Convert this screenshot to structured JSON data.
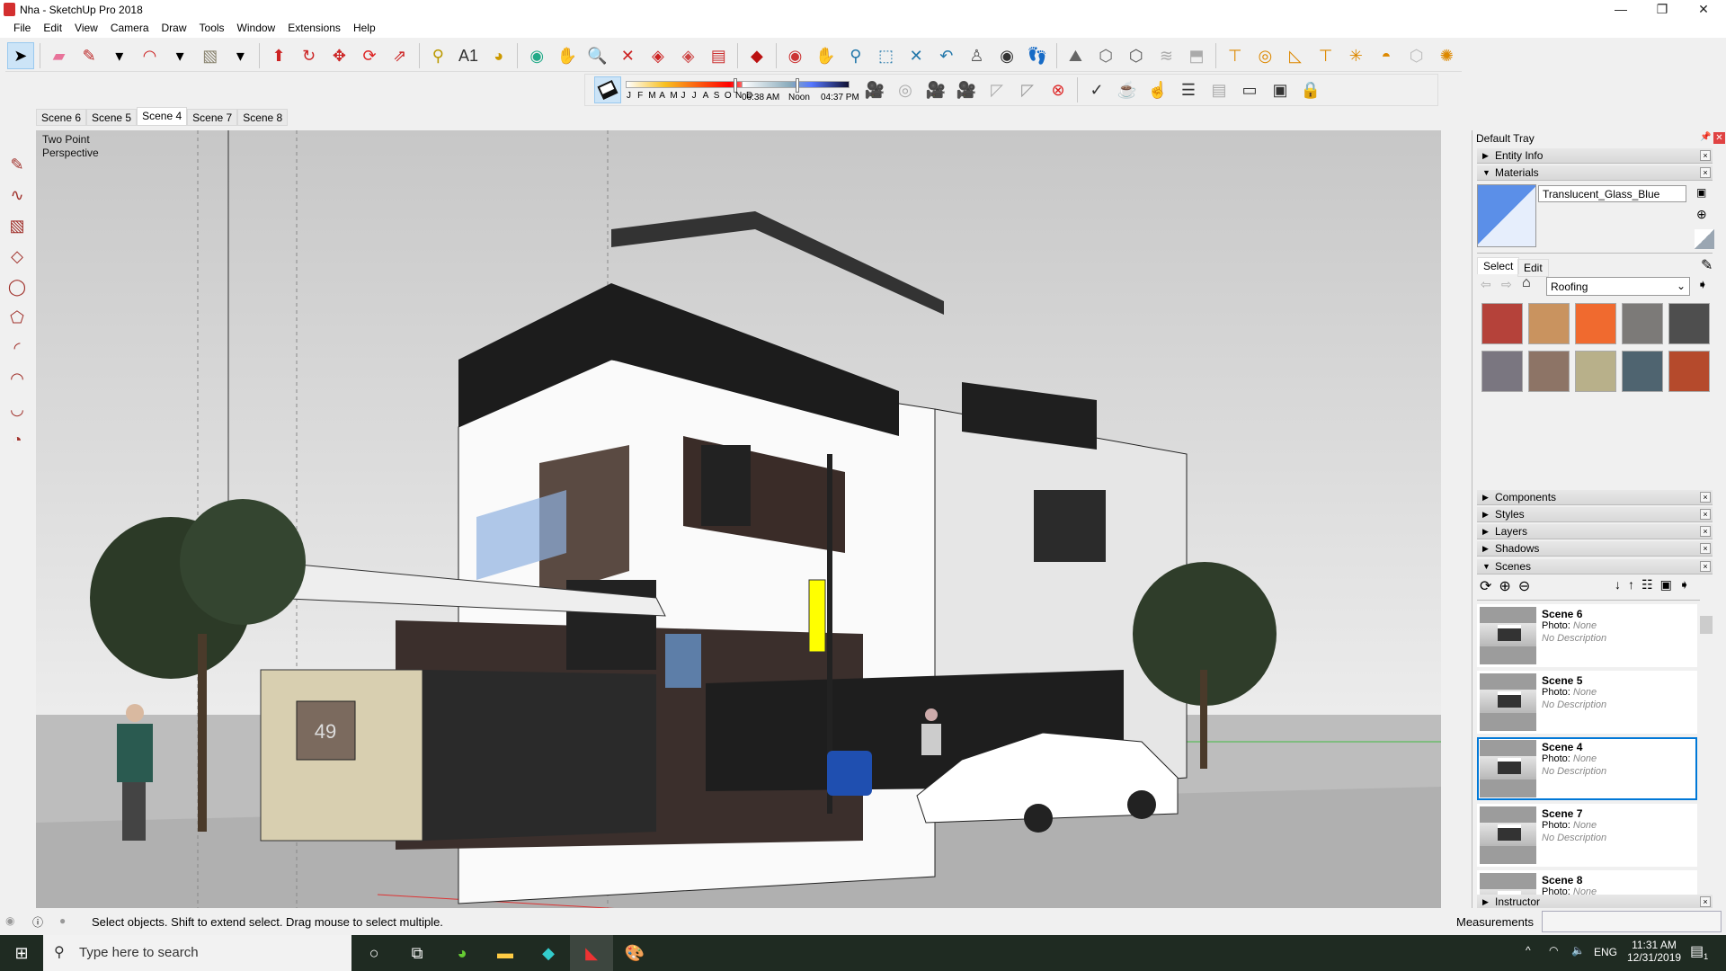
{
  "window": {
    "title": "Nha - SketchUp Pro 2018",
    "minimize": "—",
    "restore": "❐",
    "close": "✕"
  },
  "menu": [
    "File",
    "Edit",
    "View",
    "Camera",
    "Draw",
    "Tools",
    "Window",
    "Extensions",
    "Help"
  ],
  "toolbar_main": [
    {
      "icon": "select-arrow-icon",
      "g": "➤",
      "c": "#000",
      "sel": true
    },
    {
      "sep": true
    },
    {
      "icon": "eraser-icon",
      "g": "▰",
      "c": "#e8739a"
    },
    {
      "icon": "pencil-line-icon",
      "g": "✎",
      "c": "#b22"
    },
    {
      "icon": "dropdown-arrow-icon",
      "g": "▾",
      "c": "#000"
    },
    {
      "icon": "arc-icon",
      "g": "◠",
      "c": "#c22"
    },
    {
      "icon": "dropdown-arrow-icon",
      "g": "▾",
      "c": "#000"
    },
    {
      "icon": "rectangle-icon",
      "g": "▧",
      "c": "#8a8470"
    },
    {
      "icon": "dropdown-arrow-icon",
      "g": "▾",
      "c": "#000"
    },
    {
      "sep": true
    },
    {
      "icon": "push-pull-icon",
      "g": "⬆",
      "c": "#c22"
    },
    {
      "icon": "follow-me-icon",
      "g": "↻",
      "c": "#c22"
    },
    {
      "icon": "move-icon",
      "g": "✥",
      "c": "#c22"
    },
    {
      "icon": "rotate-icon",
      "g": "⟳",
      "c": "#d22"
    },
    {
      "icon": "scale-icon",
      "g": "⇗",
      "c": "#c22"
    },
    {
      "sep": true
    },
    {
      "icon": "tape-measure-icon",
      "g": "⚲",
      "c": "#b90"
    },
    {
      "icon": "text-icon",
      "g": "A1",
      "c": "#333"
    },
    {
      "icon": "paint-bucket-icon",
      "g": "◕",
      "c": "#c90"
    },
    {
      "sep": true
    },
    {
      "icon": "orbit-icon",
      "g": "◉",
      "c": "#2a8"
    },
    {
      "icon": "pan-hand-icon",
      "g": "✋",
      "c": "#d9b"
    },
    {
      "icon": "zoom-icon",
      "g": "🔍",
      "c": "#27a"
    },
    {
      "icon": "zoom-extents-icon",
      "g": "✕",
      "c": "#c22"
    },
    {
      "icon": "section-plane-icon",
      "g": "◈",
      "c": "#c22"
    },
    {
      "icon": "section-display-icon",
      "g": "◈",
      "c": "#c44"
    },
    {
      "icon": "section-fill-icon",
      "g": "▤",
      "c": "#c33"
    },
    {
      "sep": true
    },
    {
      "icon": "ruby-console-icon",
      "g": "◆",
      "c": "#b11"
    },
    {
      "sep": true
    },
    {
      "icon": "orbit-icon",
      "g": "◉",
      "c": "#c33"
    },
    {
      "icon": "pan-hand-icon",
      "g": "✋",
      "c": "#d9b"
    },
    {
      "icon": "zoom-icon",
      "g": "⚲",
      "c": "#27a"
    },
    {
      "icon": "zoom-window-icon",
      "g": "⬚",
      "c": "#27a"
    },
    {
      "icon": "zoom-extents-icon",
      "g": "✕",
      "c": "#27a"
    },
    {
      "icon": "previous-view-icon",
      "g": "↶",
      "c": "#27a"
    },
    {
      "icon": "position-camera-icon",
      "g": "♙",
      "c": "#555"
    },
    {
      "icon": "look-around-icon",
      "g": "◉",
      "c": "#333"
    },
    {
      "icon": "walk-icon",
      "g": "👣",
      "c": "#333"
    },
    {
      "sep": true
    },
    {
      "icon": "sandbox-contours-icon",
      "g": "⛰",
      "c": "#666"
    },
    {
      "icon": "iso-view-icon",
      "g": "⬡",
      "c": "#666"
    },
    {
      "icon": "top-view-icon",
      "g": "⬡",
      "c": "#555"
    },
    {
      "icon": "smoove-icon",
      "g": "≋",
      "c": "#aaa"
    },
    {
      "icon": "stamp-icon",
      "g": "⬒",
      "c": "#aaa"
    },
    {
      "sep": true
    },
    {
      "icon": "solid-union-icon",
      "g": "⊤",
      "c": "#d80"
    },
    {
      "icon": "solid-intersect-icon",
      "g": "◎",
      "c": "#d80"
    },
    {
      "icon": "solid-subtract-icon",
      "g": "◺",
      "c": "#d80"
    },
    {
      "icon": "solid-trim-icon",
      "g": "⊤",
      "c": "#d80"
    },
    {
      "icon": "solid-split-icon",
      "g": "✳",
      "c": "#d80"
    },
    {
      "icon": "outer-shell-icon",
      "g": "◓",
      "c": "#d80"
    },
    {
      "icon": "solid-tools-icon",
      "g": "⬡",
      "c": "#bbb"
    },
    {
      "icon": "sun-icon",
      "g": "✺",
      "c": "#d80"
    }
  ],
  "toolbar_shadow": {
    "months": [
      "J",
      "F",
      "M",
      "A",
      "M",
      "J",
      "J",
      "A",
      "S",
      "O",
      "N",
      "D"
    ],
    "date_fraction": 0.83,
    "time_start": "06:38 AM",
    "time_mid": "Noon",
    "time_end": "04:37 PM",
    "time_fraction": 0.5
  },
  "toolbar_secondary": [
    {
      "icon": "add-camera-icon",
      "g": "🎥",
      "c": "#222"
    },
    {
      "icon": "photo-match-icon",
      "g": "◎",
      "c": "#aaa"
    },
    {
      "icon": "camera-lock-icon",
      "g": "🎥",
      "c": "#aaa"
    },
    {
      "icon": "camera-unlock-icon",
      "g": "🎥",
      "c": "#aaa"
    },
    {
      "icon": "frustum-icon",
      "g": "◸",
      "c": "#aaa"
    },
    {
      "icon": "frustum-fill-icon",
      "g": "◸",
      "c": "#999"
    },
    {
      "icon": "delete-camera-icon",
      "g": "⊗",
      "c": "#d22"
    },
    {
      "sep": true
    },
    {
      "icon": "check-validity-icon",
      "g": "✓",
      "c": "#333"
    },
    {
      "icon": "teapot-icon",
      "g": "☕",
      "c": "#333"
    },
    {
      "icon": "render-hand-icon",
      "g": "☝",
      "c": "#333"
    },
    {
      "icon": "layout-icon",
      "g": "☰",
      "c": "#333"
    },
    {
      "icon": "layout-gray-icon",
      "g": "▤",
      "c": "#aaa"
    },
    {
      "icon": "window-icon",
      "g": "▭",
      "c": "#333"
    },
    {
      "icon": "window-camera-icon",
      "g": "▣",
      "c": "#333"
    },
    {
      "icon": "lock-icon",
      "g": "🔒",
      "c": "#aaa"
    }
  ],
  "scene_tabs": [
    {
      "label": "Scene 6"
    },
    {
      "label": "Scene 5"
    },
    {
      "label": "Scene 4",
      "active": true
    },
    {
      "label": "Scene 7"
    },
    {
      "label": "Scene 8"
    }
  ],
  "left_tools": [
    "pencil-icon",
    "freehand-icon",
    "rectangle-icon",
    "rotated-rectangle-icon",
    "circle-icon",
    "polygon-icon",
    "arc-icon",
    "two-point-arc-icon",
    "three-point-arc-icon",
    "pie-icon"
  ],
  "viewport": {
    "camera_label": "Two Point Perspective",
    "house_number": "49"
  },
  "tray": {
    "title": "Default Tray",
    "entity_info": "Entity Info",
    "materials": {
      "label": "Materials",
      "name_value": "Translucent_Glass_Blue",
      "preview_color": "#5b8fe8",
      "tab_select": "Select",
      "tab_edit": "Edit",
      "collection": "Roofing",
      "swatches": [
        "#b5423a",
        "#c9935f",
        "#f06a2f",
        "#7c7a78",
        "#4e4e4e",
        "#7a7680",
        "#8d7466",
        "#b8b08a",
        "#4f6470",
        "#b54a2c"
      ]
    },
    "collapsed": [
      "Components",
      "Styles",
      "Layers",
      "Shadows"
    ],
    "scenes": {
      "label": "Scenes",
      "photo_label": "Photo:",
      "photo_value": "None",
      "desc": "No Description",
      "items": [
        {
          "name": "Scene 6"
        },
        {
          "name": "Scene 5"
        },
        {
          "name": "Scene 4",
          "selected": true
        },
        {
          "name": "Scene 7"
        },
        {
          "name": "Scene 8"
        }
      ]
    },
    "instructor": "Instructor"
  },
  "status": {
    "message": "Select objects. Shift to extend select. Drag mouse to select multiple.",
    "measurements_label": "Measurements",
    "measurements_value": ""
  },
  "taskbar": {
    "search_placeholder": "Type here to search",
    "language": "ENG",
    "time": "11:31 AM",
    "date": "12/31/2019",
    "notifications": "1"
  }
}
